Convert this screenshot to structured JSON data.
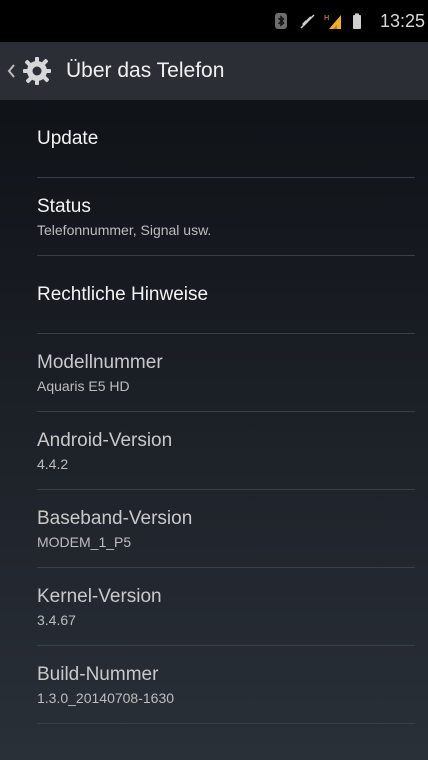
{
  "status_bar": {
    "icons": [
      "bluetooth-icon",
      "mute-icon",
      "signal-icon",
      "battery-icon"
    ],
    "time": "13:25"
  },
  "action_bar": {
    "icons": [
      "back-icon",
      "settings-icon"
    ],
    "title": "Über das Telefon"
  },
  "list": [
    {
      "title": "Update",
      "subtitle": ""
    },
    {
      "title": "Status",
      "subtitle": "Telefonnummer, Signal usw."
    },
    {
      "title": "Rechtliche Hinweise",
      "subtitle": ""
    },
    {
      "title": "Modellnummer",
      "subtitle": "Aquaris E5 HD"
    },
    {
      "title": "Android-Version",
      "subtitle": "4.4.2"
    },
    {
      "title": "Baseband-Version",
      "subtitle": "MODEM_1_P5"
    },
    {
      "title": "Kernel-Version",
      "subtitle": "3.4.67"
    },
    {
      "title": "Build-Nummer",
      "subtitle": "1.3.0_20140708-1630"
    }
  ],
  "colors": {
    "status_bar_bg": "#000000",
    "action_bar_bg": "#2b2f35",
    "signal_accent": "#f2b01e"
  }
}
